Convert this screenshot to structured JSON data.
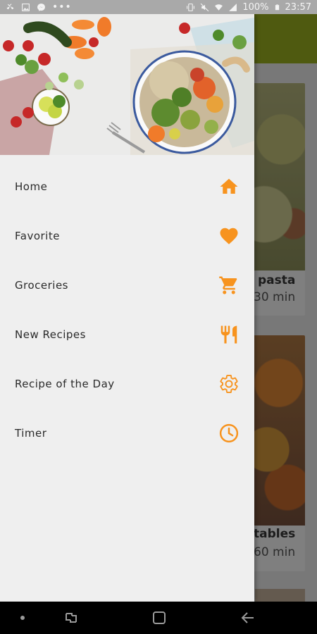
{
  "status_bar": {
    "battery_text": "100%",
    "time": "23:57",
    "left_icons": [
      "missed-call-icon",
      "image-icon",
      "messenger-icon",
      "more-icon"
    ],
    "right_icons": [
      "vibrate-icon",
      "mute-icon",
      "wifi-icon",
      "signal-icon",
      "battery-icon"
    ]
  },
  "background_cards": [
    {
      "title": "pasta",
      "time": "30 min"
    },
    {
      "title": "tables",
      "time": "60 min"
    }
  ],
  "drawer": {
    "header_image": "food-bowl-photo",
    "items": [
      {
        "label": "Home",
        "icon": "home-icon"
      },
      {
        "label": "Favorite",
        "icon": "heart-icon"
      },
      {
        "label": "Groceries",
        "icon": "cart-icon"
      },
      {
        "label": "New Recipes",
        "icon": "cutlery-icon"
      },
      {
        "label": "Recipe of the Day",
        "icon": "gear-icon"
      },
      {
        "label": "Timer",
        "icon": "clock-icon"
      }
    ]
  },
  "nav_bar": {
    "buttons": [
      "menu-dot-icon",
      "recent-apps-icon",
      "home-button-icon",
      "back-icon"
    ]
  },
  "colors": {
    "accent": "#f7931e",
    "drawer_bg": "#efefef",
    "toolbar": "#7a8a1a",
    "text": "#2a2a2a"
  }
}
